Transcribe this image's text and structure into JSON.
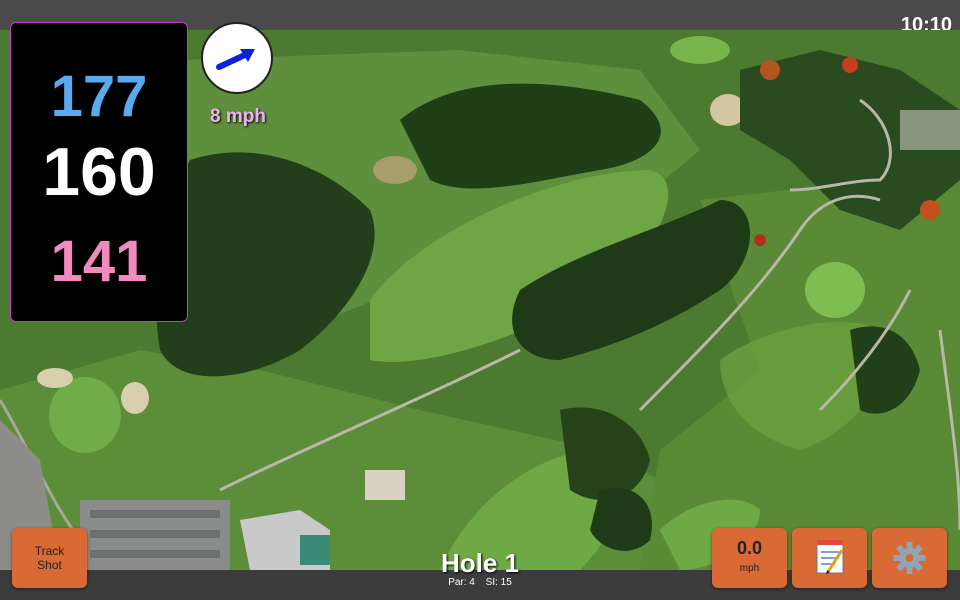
{
  "status_bar": {
    "time": "10:10"
  },
  "distances": {
    "back": "177",
    "center": "160",
    "front": "141"
  },
  "wind": {
    "speed": "8 mph",
    "direction_icon": "arrow-icon"
  },
  "hole": {
    "title": "Hole 1",
    "par": "Par: 4",
    "si": "SI: 15"
  },
  "buttons": {
    "track_line1": "Track",
    "track_line2": "Shot",
    "speed_value": "0.0",
    "speed_unit": "mph",
    "notes_icon": "notepad-icon",
    "settings_icon": "gear-icon"
  },
  "colors": {
    "back": "#5aaaf2",
    "center": "#ffffff",
    "front": "#f28ac0",
    "button": "#d96a35",
    "wind_text": "#f2b0f2"
  }
}
